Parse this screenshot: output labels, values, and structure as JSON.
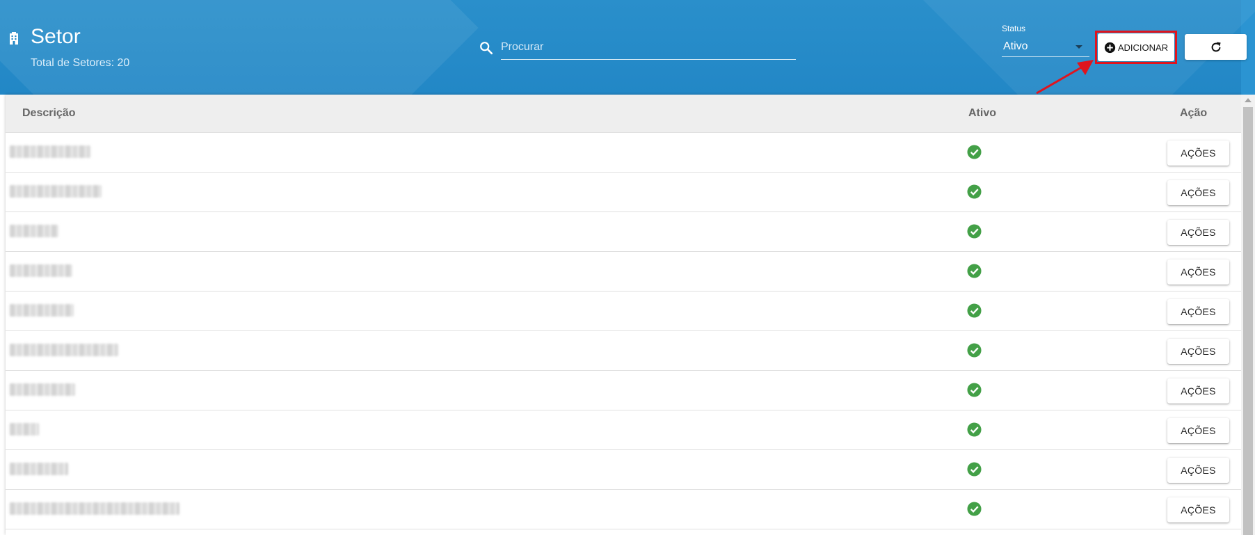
{
  "header": {
    "title": "Setor",
    "subtitle": "Total de Setores: 20",
    "title_icon": "building-icon"
  },
  "search": {
    "placeholder": "Procurar",
    "value": "",
    "icon": "search-icon"
  },
  "status_filter": {
    "label": "Status",
    "value": "Ativo"
  },
  "toolbar": {
    "add_label": "ADICIONAR",
    "add_icon": "plus-circle-icon",
    "refresh_icon": "refresh-icon"
  },
  "annotation": {
    "highlight_color": "#e0141e"
  },
  "colors": {
    "header_bg": "#2287c6",
    "active_check": "#43a047",
    "table_header_bg": "#eeeeee"
  },
  "table": {
    "columns": [
      "Descrição",
      "Ativo",
      "Ação"
    ],
    "rows": [
      {
        "description": "xxxxxxxxxxxxxx",
        "active_icon": "check-circle-icon",
        "action_label": "AÇÕES"
      },
      {
        "description": "xxxxxxxxxxxxxxxx",
        "active_icon": "check-circle-icon",
        "action_label": "AÇÕES"
      },
      {
        "description": "xxxxxxxx",
        "active_icon": "check-circle-icon",
        "action_label": "AÇÕES"
      },
      {
        "description": "xxxxxxxxxx",
        "active_icon": "check-circle-icon",
        "action_label": "AÇÕES"
      },
      {
        "description": "xxxxxxxxxxx",
        "active_icon": "check-circle-icon",
        "action_label": "AÇÕES"
      },
      {
        "description": "xxxxxxxxxxxxxxxxxxx",
        "active_icon": "check-circle-icon",
        "action_label": "AÇÕES"
      },
      {
        "description": "xxxxxxxxxxx",
        "active_icon": "check-circle-icon",
        "action_label": "AÇÕES"
      },
      {
        "description": "xxxxx",
        "active_icon": "check-circle-icon",
        "action_label": "AÇÕES"
      },
      {
        "description": "xxxxxxxxxx",
        "active_icon": "check-circle-icon",
        "action_label": "AÇÕES"
      },
      {
        "description": "xxxxxxxxxxxxxxxxxxxxxxxxxxxxxx",
        "active_icon": "check-circle-icon",
        "action_label": "AÇÕES"
      }
    ]
  }
}
